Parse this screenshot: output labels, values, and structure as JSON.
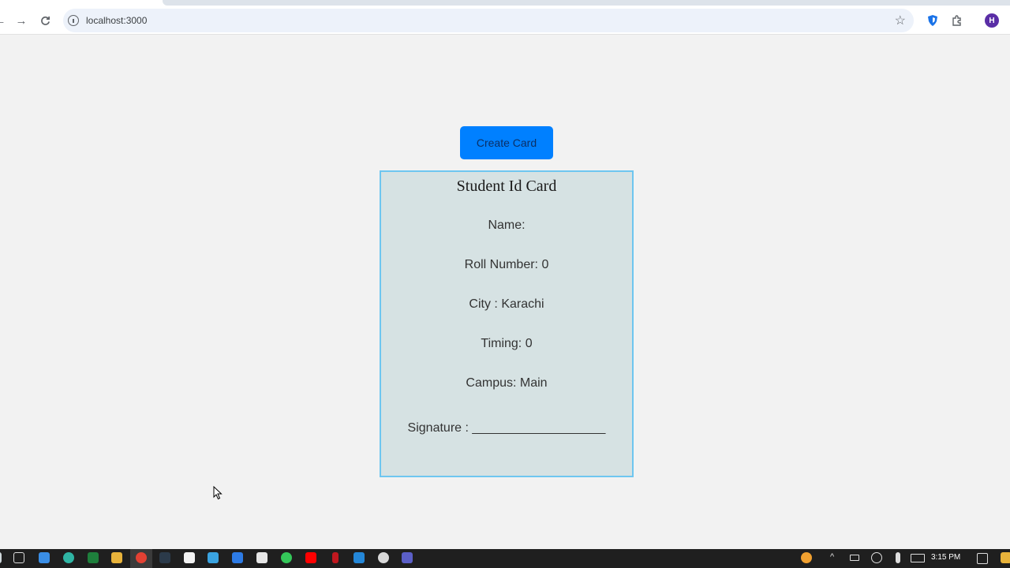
{
  "browser": {
    "url": "localhost:3000",
    "profile_initial": "H"
  },
  "page": {
    "create_button_label": "Create Card",
    "card": {
      "title": "Student Id Card",
      "fields": [
        {
          "label": "Name:",
          "value": ""
        },
        {
          "label": "Roll Number: ",
          "value": "0"
        },
        {
          "label": "City : ",
          "value": "Karachi"
        },
        {
          "label": "Timing: ",
          "value": "0"
        },
        {
          "label": "Campus: ",
          "value": "Main"
        },
        {
          "label": "Signature : ",
          "value": "___________________"
        }
      ]
    }
  },
  "taskbar": {
    "time": "3:15 PM",
    "apps": [
      "task-view",
      "widgets",
      "edge",
      "word",
      "file-explorer",
      "chrome",
      "terminal",
      "store",
      "play",
      "mail",
      "calendar",
      "whatsapp",
      "youtube",
      "app-red",
      "vscode",
      "github",
      "teams"
    ]
  },
  "colors": {
    "page_bg": "#f2f2f2",
    "button_bg": "#0080ff",
    "card_bg": "#d6e2e3",
    "card_border": "#6ec6f0"
  }
}
